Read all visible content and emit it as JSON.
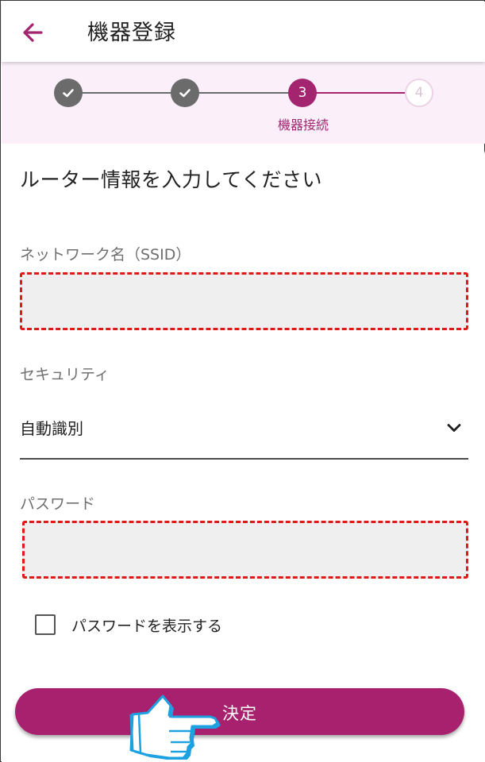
{
  "header": {
    "title": "機器登録",
    "back_icon": "arrow-left-icon"
  },
  "stepper": {
    "steps": [
      {
        "state": "completed",
        "icon": "check-icon"
      },
      {
        "state": "completed",
        "icon": "check-icon"
      },
      {
        "state": "active",
        "number": "3",
        "label": "機器接続"
      },
      {
        "state": "upcoming",
        "number": "4"
      }
    ]
  },
  "form": {
    "heading": "ルーター情報を入力してください",
    "ssid": {
      "label": "ネットワーク名（SSID）",
      "value": ""
    },
    "security": {
      "label": "セキュリティ",
      "value": "自動識別",
      "icon": "chevron-down-icon"
    },
    "password": {
      "label": "パスワード",
      "value": ""
    },
    "show_password": {
      "label": "パスワードを表示する",
      "checked": false
    },
    "submit_label": "決定"
  },
  "colors": {
    "accent": "#a8216e",
    "step_done": "#6b6b6b",
    "stepper_bg": "#fbf0fa",
    "highlight_border": "#e01818",
    "pointer_hand": "#1da1e0"
  }
}
